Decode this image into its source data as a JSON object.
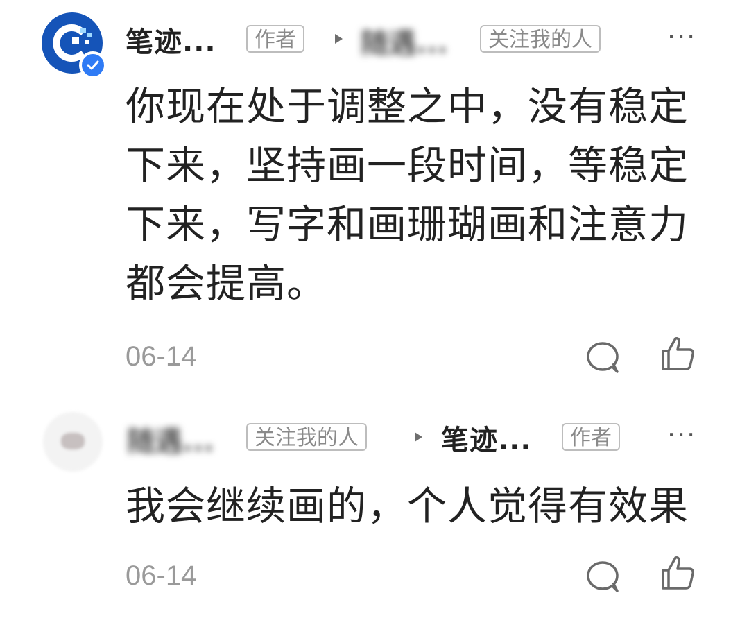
{
  "comments": [
    {
      "author": "笔迹...",
      "author_tag": "作者",
      "reply_to": "随遇...",
      "reply_to_tag": "关注我的人",
      "more": "···",
      "text": "你现在处于调整之中，没有稳定下来，坚持画一段时间，等稳定下来，写字和画珊瑚画和注意力都会提高。",
      "date": "06-14",
      "avatar_icon": "brand-logo-avatar",
      "badge_icon": "verified-check-icon",
      "reply_icon": "comment-bubble-icon",
      "like_icon": "thumbs-up-icon"
    },
    {
      "author": "随遇...",
      "author_tag": "关注我的人",
      "reply_to": "笔迹...",
      "reply_to_tag": "作者",
      "more": "···",
      "text": "我会继续画的，个人觉得有效果",
      "date": "06-14",
      "avatar_icon": "blurred-user-avatar",
      "reply_icon": "comment-bubble-icon",
      "like_icon": "thumbs-up-icon"
    }
  ],
  "colors": {
    "badge": "#2f7bf5",
    "avatar_bg": "#1554b8",
    "meta_gray": "#9a9a9a"
  }
}
